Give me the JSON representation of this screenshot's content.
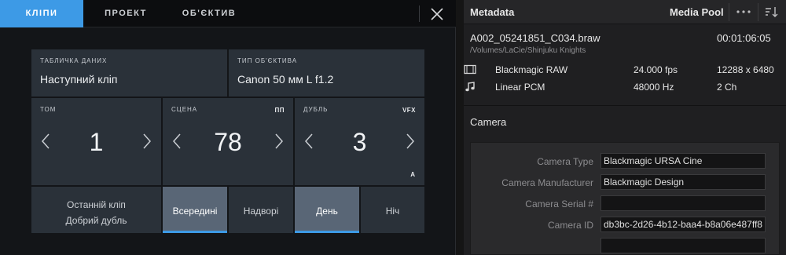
{
  "slate": {
    "tabs": [
      {
        "label": "КЛІПИ",
        "active": true
      },
      {
        "label": "ПРОЕКТ",
        "active": false
      },
      {
        "label": "ОБ'ЄКТИВ",
        "active": false
      }
    ],
    "data_plate": {
      "label": "ТАБЛИЧКА ДАНИХ",
      "value": "Наступний кліп"
    },
    "lens_type": {
      "label": "ТИП ОБ'ЄКТИВА",
      "value": "Canon 50 мм L f1.2"
    },
    "reel": {
      "label": "ТОМ",
      "value": "1"
    },
    "scene": {
      "label": "СЦЕНА",
      "tag": "ПП",
      "value": "78"
    },
    "take": {
      "label": "ДУБЛЬ",
      "tag": "VFX",
      "value": "3",
      "flag": "A"
    },
    "last_clip": {
      "line1": "Останній кліп",
      "line2": "Добрий дубль"
    },
    "interior": {
      "label": "Всередині",
      "selected": true
    },
    "exterior": {
      "label": "Надворі",
      "selected": false
    },
    "day": {
      "label": "День",
      "selected": true
    },
    "night": {
      "label": "Ніч",
      "selected": false
    }
  },
  "metadata": {
    "title": "Metadata",
    "media_pool": "Media Pool",
    "clip": {
      "name": "A002_05241851_C034.braw",
      "duration": "00:01:06:05",
      "path": "/Volumes/LaCie/Shinjuku Knights"
    },
    "video": {
      "icon": "film-icon",
      "codec": "Blackmagic RAW",
      "fps": "24.000 fps",
      "resolution": "12288 x 6480"
    },
    "audio": {
      "icon": "music-note-icon",
      "codec": "Linear PCM",
      "rate": "48000 Hz",
      "channels": "2 Ch"
    },
    "section": "Camera",
    "fields": [
      {
        "label": "Camera Type",
        "value": "Blackmagic URSA Cine"
      },
      {
        "label": "Camera Manufacturer",
        "value": "Blackmagic Design"
      },
      {
        "label": "Camera Serial #",
        "value": ""
      },
      {
        "label": "Camera ID",
        "value": "db3bc-2d26-4b12-baa4-b8a06e487ff8"
      },
      {
        "label": "",
        "value": ""
      }
    ]
  },
  "colors": {
    "accent": "#3d9ae6",
    "cell": "#2a3139",
    "selected": "#596676",
    "panel": "#1f1f21"
  }
}
